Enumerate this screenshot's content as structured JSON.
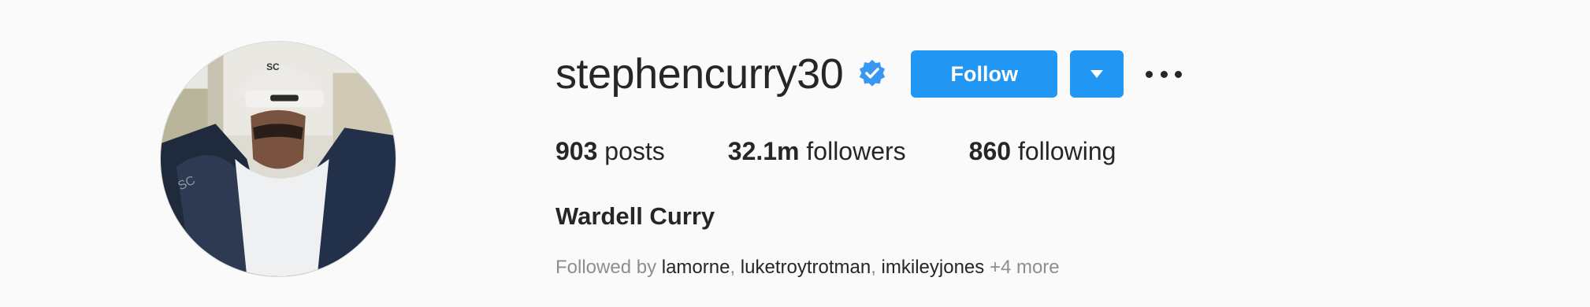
{
  "profile": {
    "username": "stephencurry30",
    "full_name": "Wardell Curry",
    "verified_icon": "verified-badge-icon",
    "avatar_icon": "profile-photo"
  },
  "actions": {
    "follow_label": "Follow",
    "dropdown_icon": "chevron-down-icon",
    "more_icon": "more-options-icon",
    "accent_color": "#2196f3"
  },
  "stats": [
    {
      "value": "903",
      "label": "posts"
    },
    {
      "value": "32.1m",
      "label": "followers"
    },
    {
      "value": "860",
      "label": "following"
    }
  ],
  "followed_by": {
    "prefix": "Followed by",
    "users": [
      "lamorne",
      "luketroytrotman",
      "imkileyjones"
    ],
    "more": "+4 more"
  }
}
